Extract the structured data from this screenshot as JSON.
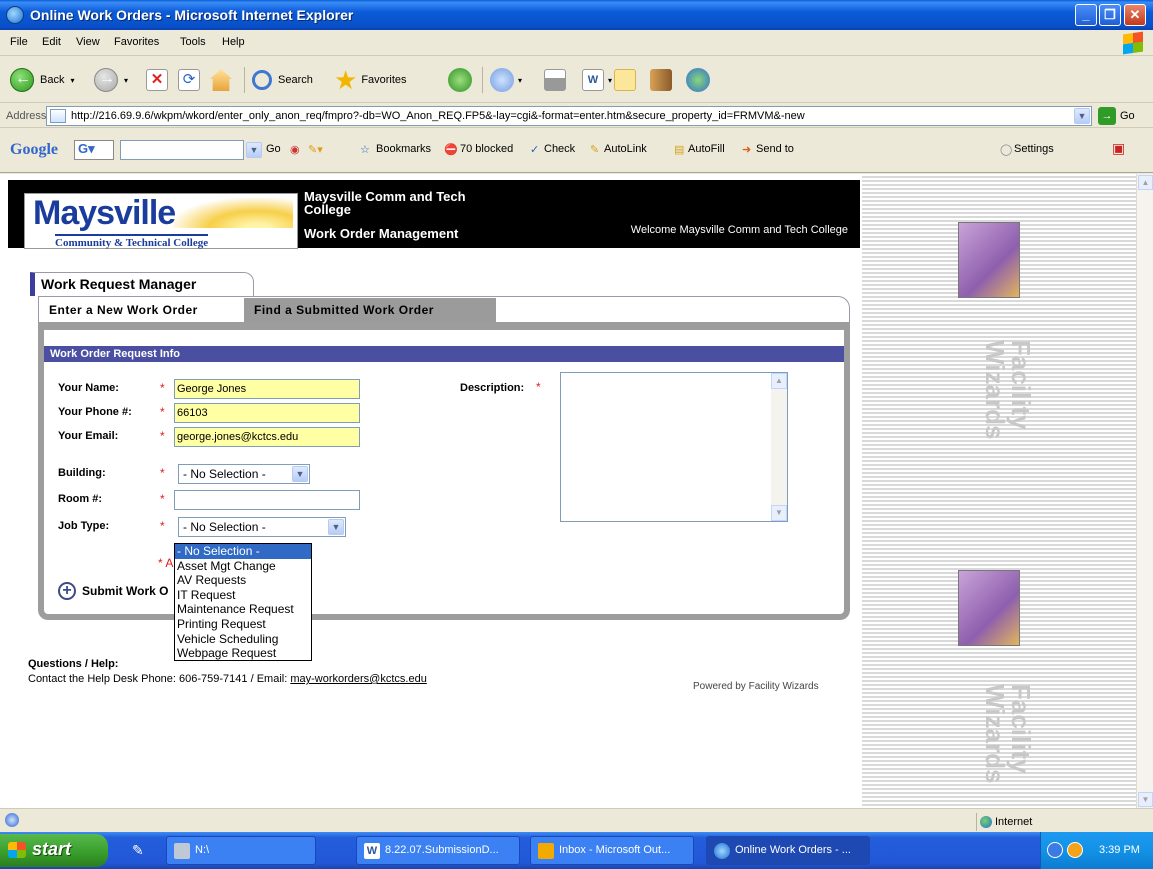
{
  "window": {
    "title": "Online Work Orders - Microsoft Internet Explorer",
    "controls": {
      "minimize": "_",
      "maximize": "❐",
      "close": "✕"
    }
  },
  "menu": [
    "File",
    "Edit",
    "View",
    "Favorites",
    "Tools",
    "Help"
  ],
  "toolbar": {
    "back": "Back",
    "search": "Search",
    "favorites": "Favorites"
  },
  "address": {
    "label": "Address",
    "url": "http://216.69.9.6/wkpm/wkord/enter_only_anon_req/fmpro?-db=WO_Anon_REQ.FP5&-lay=cgi&-format=enter.htm&secure_property_id=FRMVM&-new",
    "go": "Go"
  },
  "googlebar": {
    "logo": "Google",
    "go": "Go",
    "bookmarks": "Bookmarks",
    "blocked": "70 blocked",
    "check": "Check",
    "autolink": "AutoLink",
    "autofill": "AutoFill",
    "send_to": "Send to",
    "settings": "Settings"
  },
  "banner": {
    "logo_main": "Maysville",
    "logo_sub": "Community & Technical College",
    "college_line1": "Maysville Comm and Tech",
    "college_line2": "College",
    "system": "Work Order Management",
    "welcome": "Welcome Maysville Comm and Tech College"
  },
  "side": {
    "brand_line1": "Facility",
    "brand_line2": "Wizards"
  },
  "manager": {
    "title": "Work Request Manager",
    "tabs": [
      "Enter a New Work Order",
      "Find a Submitted Work Order"
    ]
  },
  "form": {
    "section_title": "Work Order Request Info",
    "star": "*",
    "name_label": "Your Name:",
    "name_value": "George Jones",
    "phone_label": "Your Phone #:",
    "phone_value": "66103",
    "email_label": "Your Email:",
    "email_value": "george.jones@kctcs.edu",
    "building_label": "Building:",
    "building_value": "- No Selection -",
    "room_label": "Room #:",
    "room_value": "",
    "jobtype_label": "Job Type:",
    "jobtype_value": "- No Selection -",
    "description_label": "Description:",
    "required_note": "* A",
    "submit": "Submit Work O",
    "job_options": [
      "- No Selection -",
      "Asset Mgt Change",
      "AV Requests",
      "IT Request",
      "Maintenance Request",
      "Printing Request",
      "Vehicle Scheduling",
      "Webpage Request"
    ]
  },
  "help": {
    "title": "Questions / Help:",
    "contact": "Contact the Help Desk   Phone: 606-759-7141 / Email: ",
    "email": "may-workorders@kctcs.edu",
    "powered": "Powered by Facility Wizards"
  },
  "status": {
    "zone": "Internet"
  },
  "taskbar": {
    "start": "start",
    "tasks": [
      "N:\\",
      "8.22.07.SubmissionD...",
      "Inbox - Microsoft Out...",
      "Online Work Orders - ..."
    ],
    "time": "3:39 PM"
  }
}
